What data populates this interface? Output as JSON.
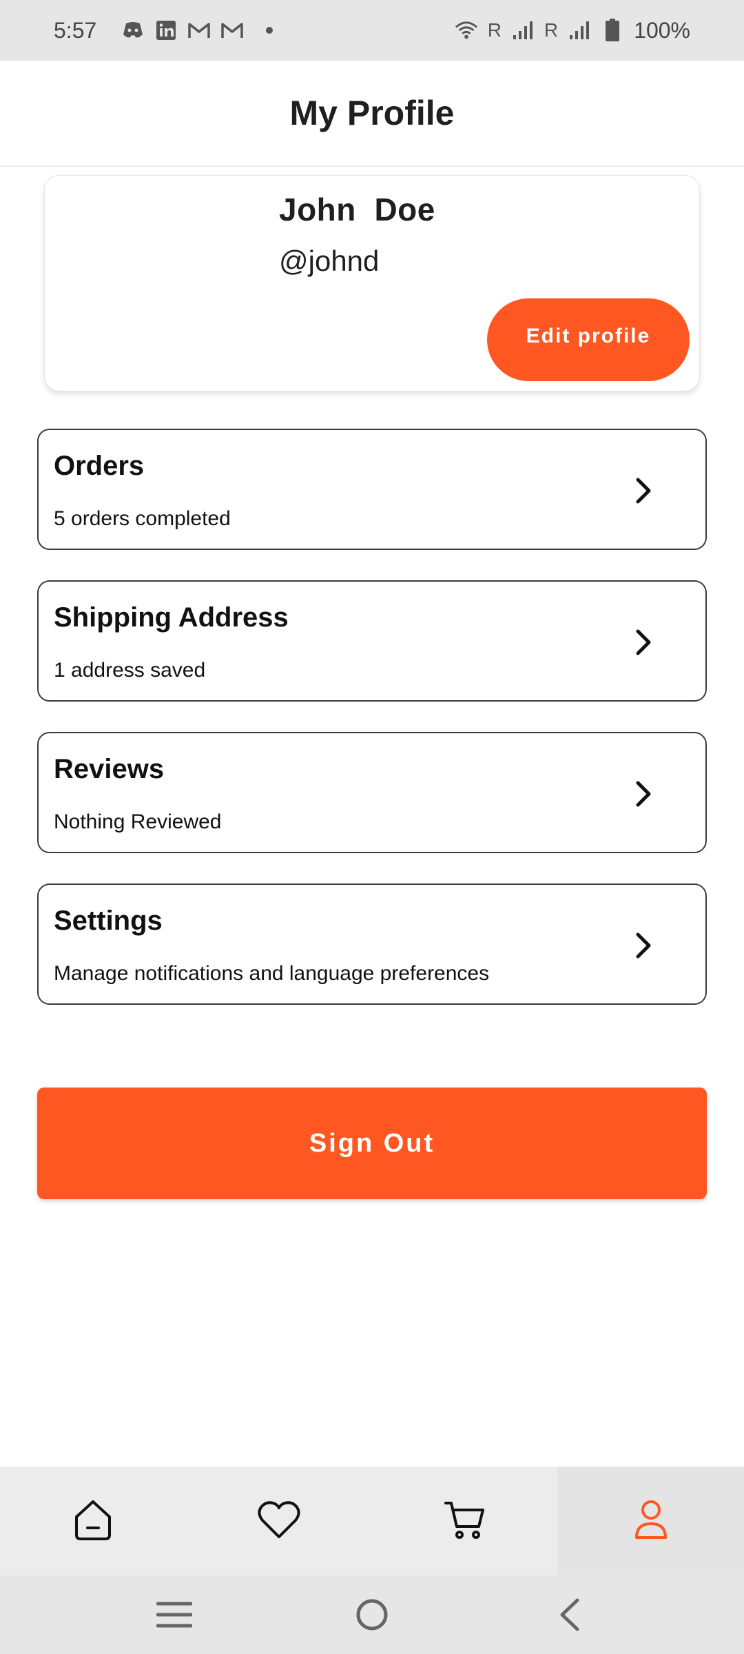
{
  "status_bar": {
    "time": "5:57",
    "notification_icons": [
      "discord-icon",
      "linkedin-icon",
      "gmail-icon",
      "gmail-icon"
    ],
    "roaming_1": "R",
    "roaming_2": "R",
    "battery": "100%"
  },
  "header": {
    "title": "My Profile"
  },
  "profile": {
    "name": "John  Doe",
    "handle": "@johnd",
    "edit_label": "Edit profile"
  },
  "menu": {
    "items": [
      {
        "title": "Orders",
        "subtitle": "5 orders completed"
      },
      {
        "title": "Shipping Address",
        "subtitle": "1 address saved"
      },
      {
        "title": "Reviews",
        "subtitle": "Nothing Reviewed"
      },
      {
        "title": "Settings",
        "subtitle": "Manage notifications and language preferences"
      }
    ]
  },
  "sign_out_label": "Sign Out",
  "bottom_nav": {
    "items": [
      "home-icon",
      "heart-icon",
      "cart-icon",
      "profile-icon"
    ],
    "active": "profile-icon"
  },
  "system_nav": [
    "recents-icon",
    "home-circle-icon",
    "back-icon"
  ],
  "colors": {
    "accent": "#ff5722",
    "text": "#111111",
    "nav_bg": "#ececec"
  }
}
